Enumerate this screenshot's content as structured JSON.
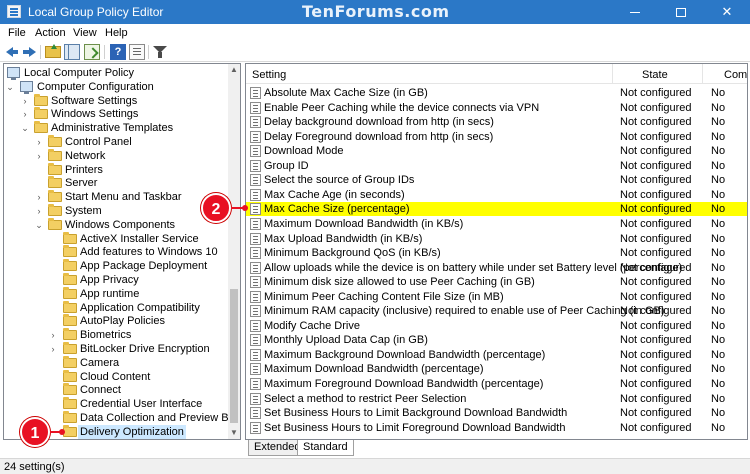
{
  "window": {
    "title": "Local Group Policy Editor",
    "watermark": "TenForums.com"
  },
  "menu": [
    "File",
    "Action",
    "View",
    "Help"
  ],
  "toolbar": {
    "icons": [
      "back-icon",
      "forward-icon",
      "up-folder-icon",
      "show-hide-tree-icon",
      "export-list-icon",
      "help-icon",
      "properties-icon",
      "filter-icon"
    ],
    "help_glyph": "?"
  },
  "tree": {
    "items": [
      {
        "label": "Local Computer Policy",
        "depth": 0,
        "icon": "policy",
        "chevron": ""
      },
      {
        "label": "Computer Configuration",
        "depth": 1,
        "icon": "pc",
        "chevron": "v"
      },
      {
        "label": "Software Settings",
        "depth": 2,
        "icon": "folder",
        "chevron": ">"
      },
      {
        "label": "Windows Settings",
        "depth": 2,
        "icon": "folder",
        "chevron": ">"
      },
      {
        "label": "Administrative Templates",
        "depth": 2,
        "icon": "folder",
        "chevron": "v"
      },
      {
        "label": "Control Panel",
        "depth": 3,
        "icon": "folder",
        "chevron": ">"
      },
      {
        "label": "Network",
        "depth": 3,
        "icon": "folder",
        "chevron": ">"
      },
      {
        "label": "Printers",
        "depth": 3,
        "icon": "folder",
        "chevron": ""
      },
      {
        "label": "Server",
        "depth": 3,
        "icon": "folder",
        "chevron": ""
      },
      {
        "label": "Start Menu and Taskbar",
        "depth": 3,
        "icon": "folder",
        "chevron": ">"
      },
      {
        "label": "System",
        "depth": 3,
        "icon": "folder",
        "chevron": ">"
      },
      {
        "label": "Windows Components",
        "depth": 3,
        "icon": "folder",
        "chevron": "v"
      },
      {
        "label": "ActiveX Installer Service",
        "depth": 4,
        "icon": "folder",
        "chevron": ""
      },
      {
        "label": "Add features to Windows 10",
        "depth": 4,
        "icon": "folder",
        "chevron": ""
      },
      {
        "label": "App Package Deployment",
        "depth": 4,
        "icon": "folder",
        "chevron": ""
      },
      {
        "label": "App Privacy",
        "depth": 4,
        "icon": "folder",
        "chevron": ""
      },
      {
        "label": "App runtime",
        "depth": 4,
        "icon": "folder",
        "chevron": ""
      },
      {
        "label": "Application Compatibility",
        "depth": 4,
        "icon": "folder",
        "chevron": ""
      },
      {
        "label": "AutoPlay Policies",
        "depth": 4,
        "icon": "folder",
        "chevron": ""
      },
      {
        "label": "Biometrics",
        "depth": 4,
        "icon": "folder",
        "chevron": ">"
      },
      {
        "label": "BitLocker Drive Encryption",
        "depth": 4,
        "icon": "folder",
        "chevron": ">"
      },
      {
        "label": "Camera",
        "depth": 4,
        "icon": "folder",
        "chevron": ""
      },
      {
        "label": "Cloud Content",
        "depth": 4,
        "icon": "folder",
        "chevron": ""
      },
      {
        "label": "Connect",
        "depth": 4,
        "icon": "folder",
        "chevron": ""
      },
      {
        "label": "Credential User Interface",
        "depth": 4,
        "icon": "folder",
        "chevron": ""
      },
      {
        "label": "Data Collection and Preview Builds",
        "depth": 4,
        "icon": "folder",
        "chevron": ""
      },
      {
        "label": "Delivery Optimization",
        "depth": 4,
        "icon": "folder",
        "chevron": "",
        "selected": true
      }
    ]
  },
  "columns": {
    "setting": "Setting",
    "state": "State",
    "comment": "Comment"
  },
  "settings": [
    {
      "name": "Absolute Max Cache Size (in GB)",
      "state": "Not configured",
      "comment": "No"
    },
    {
      "name": "Enable Peer Caching while the device connects via VPN",
      "state": "Not configured",
      "comment": "No"
    },
    {
      "name": "Delay background download from http (in secs)",
      "state": "Not configured",
      "comment": "No"
    },
    {
      "name": "Delay Foreground download from http (in secs)",
      "state": "Not configured",
      "comment": "No"
    },
    {
      "name": "Download Mode",
      "state": "Not configured",
      "comment": "No"
    },
    {
      "name": "Group ID",
      "state": "Not configured",
      "comment": "No"
    },
    {
      "name": "Select the source of Group IDs",
      "state": "Not configured",
      "comment": "No"
    },
    {
      "name": "Max Cache Age (in seconds)",
      "state": "Not configured",
      "comment": "No"
    },
    {
      "name": "Max Cache Size (percentage)",
      "state": "Not configured",
      "comment": "No",
      "highlight": true
    },
    {
      "name": "Maximum Download Bandwidth (in KB/s)",
      "state": "Not configured",
      "comment": "No"
    },
    {
      "name": "Max Upload Bandwidth (in KB/s)",
      "state": "Not configured",
      "comment": "No"
    },
    {
      "name": "Minimum Background QoS (in KB/s)",
      "state": "Not configured",
      "comment": "No"
    },
    {
      "name": "Allow uploads while the device is on battery while under set Battery level (percentage)",
      "state": "Not configured",
      "comment": "No"
    },
    {
      "name": "Minimum disk size allowed to use Peer Caching (in GB)",
      "state": "Not configured",
      "comment": "No"
    },
    {
      "name": "Minimum Peer Caching Content File Size (in MB)",
      "state": "Not configured",
      "comment": "No"
    },
    {
      "name": "Minimum RAM capacity (inclusive) required to enable use of Peer Caching (in GB)",
      "state": "Not configured",
      "comment": "No"
    },
    {
      "name": "Modify Cache Drive",
      "state": "Not configured",
      "comment": "No"
    },
    {
      "name": "Monthly Upload Data Cap (in GB)",
      "state": "Not configured",
      "comment": "No"
    },
    {
      "name": "Maximum Background Download Bandwidth (percentage)",
      "state": "Not configured",
      "comment": "No"
    },
    {
      "name": "Maximum Download Bandwidth (percentage)",
      "state": "Not configured",
      "comment": "No"
    },
    {
      "name": "Maximum Foreground Download Bandwidth (percentage)",
      "state": "Not configured",
      "comment": "No"
    },
    {
      "name": "Select a method to restrict Peer Selection",
      "state": "Not configured",
      "comment": "No"
    },
    {
      "name": "Set Business Hours to Limit Background Download Bandwidth",
      "state": "Not configured",
      "comment": "No"
    },
    {
      "name": "Set Business Hours to Limit Foreground Download Bandwidth",
      "state": "Not configured",
      "comment": "No"
    }
  ],
  "tabs": [
    {
      "label": "Extended",
      "active": false
    },
    {
      "label": "Standard",
      "active": true
    }
  ],
  "status": "24 setting(s)",
  "callouts": [
    "1",
    "2"
  ],
  "colors": {
    "titlebar": "#2b78c7",
    "highlight": "#ffff00",
    "callout": "#e81123",
    "selection": "#cce8ff"
  }
}
